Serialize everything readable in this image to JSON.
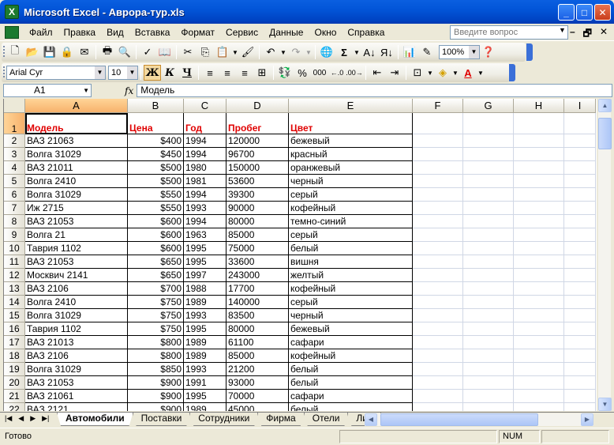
{
  "window": {
    "title": "Microsoft Excel - Аврора-тур.xls",
    "app_icon": "X"
  },
  "menu": {
    "items": [
      "Файл",
      "Правка",
      "Вид",
      "Вставка",
      "Формат",
      "Сервис",
      "Данные",
      "Окно",
      "Справка"
    ],
    "ask_placeholder": "Введите вопрос"
  },
  "toolbar": {
    "zoom": "100%",
    "font_name": "Arial Cyr",
    "font_size": "10",
    "bold": "Ж",
    "italic": "К",
    "underline": "Ч",
    "percent": "%",
    "thousands": "000"
  },
  "formula_bar": {
    "cell_ref": "A1",
    "fx": "fx",
    "value": "Модель"
  },
  "grid": {
    "columns": [
      "A",
      "B",
      "C",
      "D",
      "E",
      "F",
      "G",
      "H",
      "I"
    ],
    "header_row": [
      "Модель",
      "Цена",
      "Год",
      "Пробег",
      "Цвет"
    ],
    "rows": [
      [
        "ВАЗ 21063",
        "$400",
        "1994",
        "120000",
        "бежевый"
      ],
      [
        "Волга 31029",
        "$450",
        "1994",
        "96700",
        "красный"
      ],
      [
        "ВАЗ 21011",
        "$500",
        "1980",
        "150000",
        "оранжевый"
      ],
      [
        "Волга 2410",
        "$500",
        "1981",
        "53600",
        "черный"
      ],
      [
        "Волга 31029",
        "$550",
        "1994",
        "39300",
        "серый"
      ],
      [
        "Иж 2715",
        "$550",
        "1993",
        "90000",
        "кофейный"
      ],
      [
        "ВАЗ 21053",
        "$600",
        "1994",
        "80000",
        "темно-синий"
      ],
      [
        "Волга 21",
        "$600",
        "1963",
        "85000",
        "серый"
      ],
      [
        "Таврия 1102",
        "$600",
        "1995",
        "75000",
        "белый"
      ],
      [
        "ВАЗ 21053",
        "$650",
        "1995",
        "33600",
        "вишня"
      ],
      [
        "Москвич 2141",
        "$650",
        "1997",
        "243000",
        "желтый"
      ],
      [
        "ВАЗ 2106",
        "$700",
        "1988",
        "17700",
        "кофейный"
      ],
      [
        "Волга 2410",
        "$750",
        "1989",
        "140000",
        "серый"
      ],
      [
        "Волга 31029",
        "$750",
        "1993",
        "83500",
        "черный"
      ],
      [
        "Таврия 1102",
        "$750",
        "1995",
        "80000",
        "бежевый"
      ],
      [
        "ВАЗ 21013",
        "$800",
        "1989",
        "61100",
        "сафари"
      ],
      [
        "ВАЗ 2106",
        "$800",
        "1989",
        "85000",
        "кофейный"
      ],
      [
        "Волга 31029",
        "$850",
        "1993",
        "21200",
        "белый"
      ],
      [
        "ВАЗ 21053",
        "$900",
        "1991",
        "93000",
        "белый"
      ],
      [
        "ВАЗ 21061",
        "$900",
        "1995",
        "70000",
        "сафари"
      ],
      [
        "ВАЗ 2121",
        "$900",
        "1989",
        "45000",
        "белый"
      ]
    ]
  },
  "sheets": [
    "Автомобили",
    "Поставки",
    "Сотрудники",
    "Фирма",
    "Отели",
    "Лис"
  ],
  "status": {
    "ready": "Готово",
    "num": "NUM"
  },
  "colors": {
    "header_text": "#E00000",
    "title_bar": "#0255D8"
  }
}
